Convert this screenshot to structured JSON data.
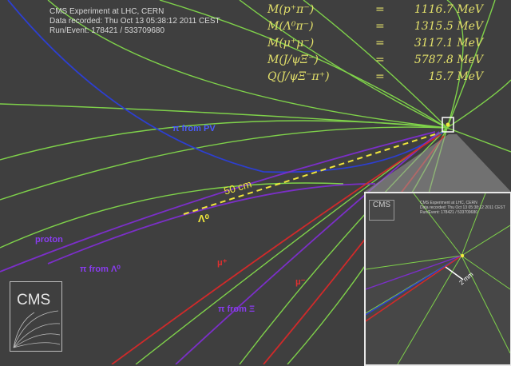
{
  "header": {
    "line1": "CMS Experiment at LHC, CERN",
    "line2": "Data recorded: Thu Oct 13 05:38:12 2011 CEST",
    "line3": "Run/Event: 178421 / 533709680"
  },
  "masses": [
    {
      "label": "M(p⁺π⁻)",
      "eq": "=",
      "value": "1116.7 MeV"
    },
    {
      "label": "M(Λ⁰π⁻)",
      "eq": "=",
      "value": "1315.5 MeV"
    },
    {
      "label": "M(μ⁺μ⁻)",
      "eq": "=",
      "value": "3117.1 MeV"
    },
    {
      "label": "M(J/ψΞ⁻)",
      "eq": "=",
      "value": "5787.8 MeV"
    },
    {
      "label": "Q(J/ψΞ⁻π⁺)",
      "eq": "=",
      "value": "15.7 MeV"
    }
  ],
  "labels": {
    "pi_pv": "π from PV",
    "scale": "50 cm",
    "lambda": "Λ⁰",
    "proton": "proton",
    "pi_lambda": "π from Λ⁰",
    "mu1": "μ⁺",
    "mu2": "μ⁻",
    "pi_xi": "π from Ξ"
  },
  "inset": {
    "scale": "2 mm",
    "logo": "CMS",
    "header1": "CMS Experiment at LHC, CERN",
    "header2": "Data recorded: Thu Oct 13 05:38:12 2011 CEST",
    "header3": "Run/Event: 178421 / 533709680"
  },
  "logo": "CMS",
  "colors": {
    "background": "#3f3f3f",
    "track_green": "#7fd24a",
    "track_blue": "#2d3fd0",
    "track_purple": "#7b2fc8",
    "track_red": "#d02a2a",
    "dashed_yellow": "#f0e63c",
    "text_yellow": "#e3e06a"
  }
}
